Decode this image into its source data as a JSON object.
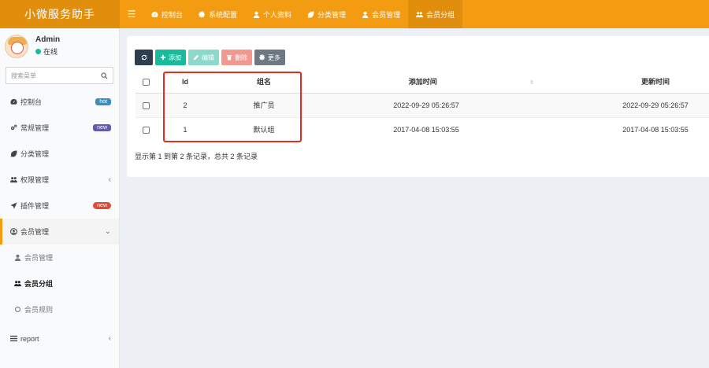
{
  "brand": "小微服务助手",
  "topnav": {
    "items": [
      {
        "label": "控制台",
        "icon": "dashboard-icon"
      },
      {
        "label": "系统配置",
        "icon": "gear-icon"
      },
      {
        "label": "个人资料",
        "icon": "user-icon"
      },
      {
        "label": "分类管理",
        "icon": "leaf-icon"
      },
      {
        "label": "会员管理",
        "icon": "user-icon"
      },
      {
        "label": "会员分组",
        "icon": "users-icon"
      }
    ]
  },
  "user": {
    "name": "Admin",
    "status": "在线"
  },
  "search": {
    "placeholder": "搜索菜单"
  },
  "sidebar": {
    "items": [
      {
        "label": "控制台",
        "badge": "hot"
      },
      {
        "label": "常规管理",
        "badge": "new"
      },
      {
        "label": "分类管理"
      },
      {
        "label": "权限管理"
      },
      {
        "label": "插件管理",
        "badge": "new"
      },
      {
        "label": "会员管理"
      },
      {
        "label": "会员管理"
      },
      {
        "label": "会员分组"
      },
      {
        "label": "会员规则"
      },
      {
        "label": "report"
      }
    ]
  },
  "toolbar": {
    "add": "添加",
    "edit": "编辑",
    "delete": "删除",
    "more": "更多"
  },
  "table": {
    "headers": [
      "Id",
      "组名",
      "添加时间",
      "更新时间"
    ],
    "rows": [
      {
        "id": "2",
        "name": "推广员",
        "created": "2022-09-29 05:26:57",
        "updated": "2022-09-29 05:26:57"
      },
      {
        "id": "1",
        "name": "默认组",
        "created": "2017-04-08 15:03:55",
        "updated": "2017-04-08 15:03:55"
      }
    ]
  },
  "summary": "显示第 1 到第 2 条记录，总共 2 条记录",
  "colors": {
    "accent": "#f39c12",
    "highlight": "#e32b1f",
    "success": "#18bc9c"
  }
}
